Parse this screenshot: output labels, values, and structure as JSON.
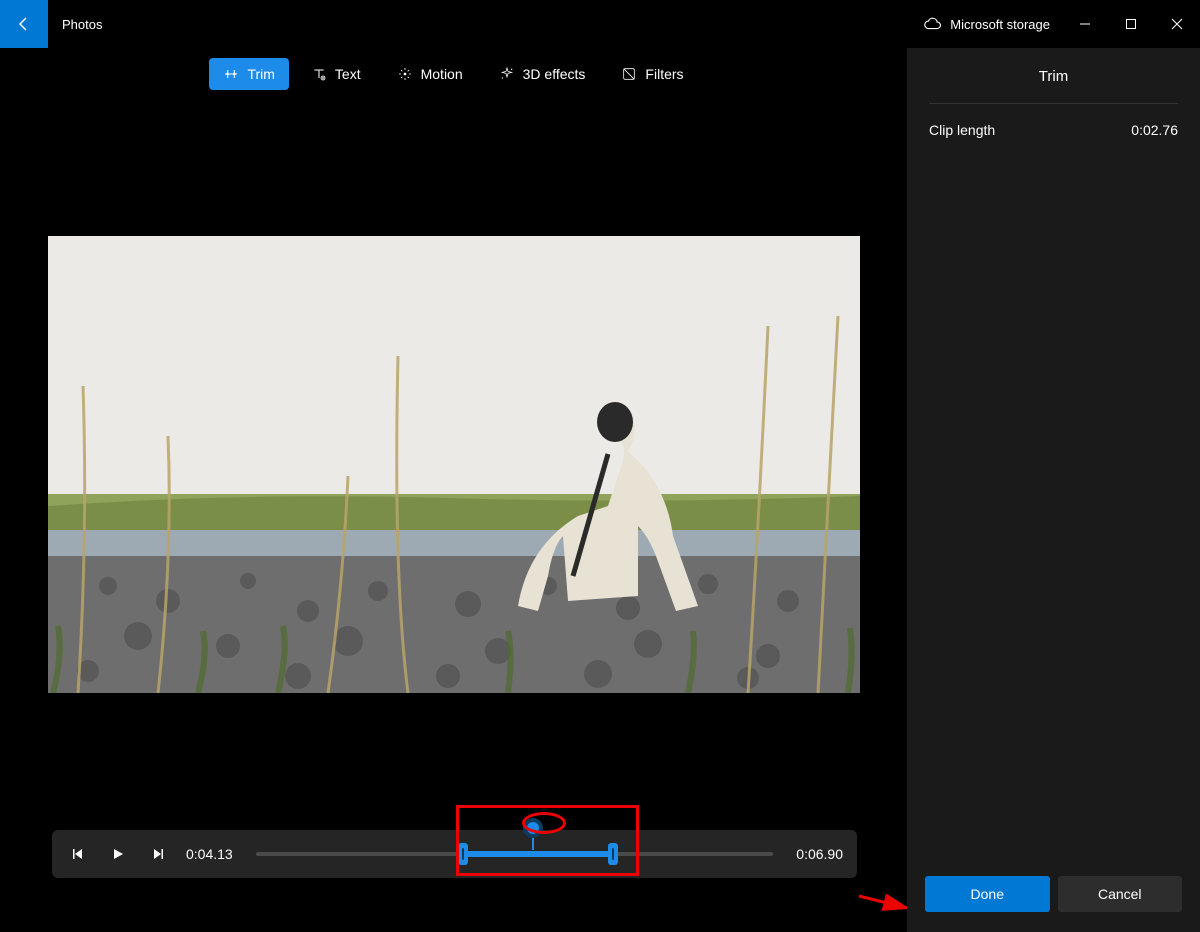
{
  "app": {
    "title": "Photos"
  },
  "storage": {
    "label": "Microsoft storage"
  },
  "toolbar": {
    "trim": "Trim",
    "text": "Text",
    "motion": "Motion",
    "effects": "3D effects",
    "filters": "Filters"
  },
  "sidebar": {
    "title": "Trim",
    "clip_length_label": "Clip length",
    "clip_length_value": "0:02.76",
    "done": "Done",
    "cancel": "Cancel"
  },
  "player": {
    "current_time": "0:04.13",
    "total_time": "0:06.90"
  },
  "icons": {
    "back": "back-icon",
    "cloud": "cloud-icon"
  }
}
